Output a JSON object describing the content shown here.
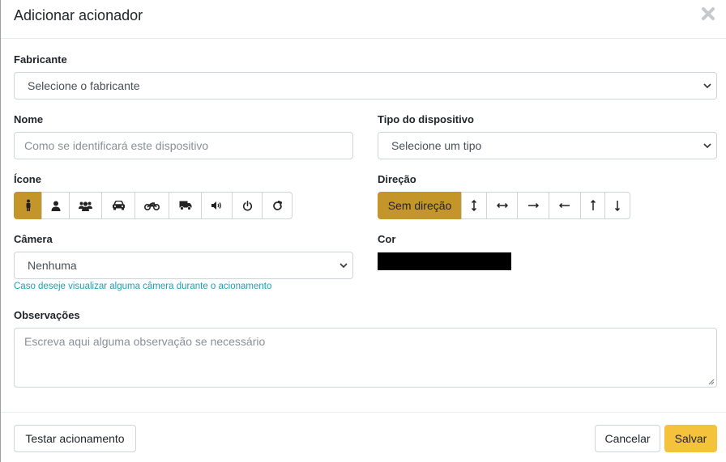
{
  "modal": {
    "title": "Adicionar acionador"
  },
  "form": {
    "manufacturer": {
      "label": "Fabricante",
      "value": "Selecione o fabricante"
    },
    "name": {
      "label": "Nome",
      "placeholder": "Como se identificará este dispositivo"
    },
    "device_type": {
      "label": "Tipo do dispositivo",
      "value": "Selecione um tipo"
    },
    "icon": {
      "label": "Ícone",
      "options": [
        "person-icon",
        "user-icon",
        "users-icon",
        "car-icon",
        "motorcycle-icon",
        "truck-icon",
        "speaker-icon",
        "power-icon",
        "refresh-icon"
      ],
      "selected": "person-icon"
    },
    "direction": {
      "label": "Direção",
      "selected_label": "Sem direção",
      "options": [
        "arrows-vertical-icon",
        "arrows-horizontal-icon",
        "arrow-right-icon",
        "arrow-left-icon",
        "arrow-up-icon",
        "arrow-down-icon"
      ]
    },
    "camera": {
      "label": "Câmera",
      "value": "Nenhuma",
      "help": "Caso deseje visualizar alguma câmera durante o acionamento"
    },
    "color": {
      "label": "Cor",
      "value": "#000000"
    },
    "notes": {
      "label": "Observações",
      "placeholder": "Escreva aqui alguma observação se necessário"
    }
  },
  "footer": {
    "test_label": "Testar acionamento",
    "cancel_label": "Cancelar",
    "save_label": "Salvar"
  },
  "colors": {
    "accent": "#c4962a",
    "primary": "#f5c33b",
    "help_text": "#17a2b8"
  }
}
